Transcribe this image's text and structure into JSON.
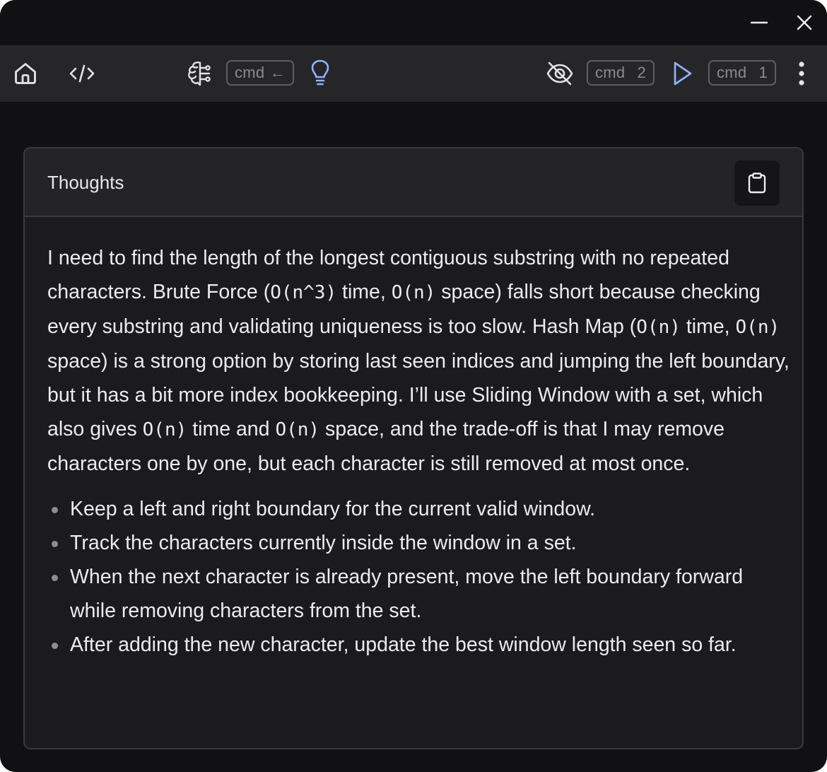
{
  "window_controls": {
    "minimize_icon": "minimize-icon",
    "close_icon": "close-icon"
  },
  "toolbar": {
    "left_icons": [
      "home-icon",
      "code-icon"
    ],
    "reasoning_icon": "brain-icon",
    "reasoning_shortcut": {
      "mod": "cmd",
      "key": "←"
    },
    "hint_icon": "lightbulb-icon",
    "hide_icon": "eye-off-icon",
    "hide_shortcut": {
      "mod": "cmd",
      "key": "2"
    },
    "run_icon": "play-icon",
    "run_shortcut": {
      "mod": "cmd",
      "key": "1"
    },
    "menu_icon": "more-vertical-icon"
  },
  "colors": {
    "accent": "#8fb4ff",
    "window_bg": "#111113",
    "toolbar_bg": "#262629",
    "card_bg": "#1b1b1e"
  },
  "thoughts": {
    "title": "Thoughts",
    "copy_icon": "clipboard-icon",
    "paragraph": {
      "t1": "I need to find the length of the longest contiguous substring with no repeated characters. Brute Force (",
      "c1": "O(n^3)",
      "t2": " time, ",
      "c2": "O(n)",
      "t3": " space) falls short because checking every substring and validating uniqueness is too slow. Hash Map (",
      "c3": "O(n)",
      "t4": " time, ",
      "c4": "O(n)",
      "t5": " space) is a strong option by storing last seen indices and jumping the left boundary, but it has a bit more index bookkeeping. I’ll use Sliding Window with a set, which also gives ",
      "c5": "O(n)",
      "t6": " time and ",
      "c6": "O(n)",
      "t7": " space, and the trade-off is that I may remove characters one by one, but each character is still removed at most once."
    },
    "bullets": [
      "Keep a left and right boundary for the current valid window.",
      "Track the characters currently inside the window in a set.",
      "When the next character is already present, move the left boundary forward while removing characters from the set.",
      "After adding the new character, update the best window length seen so far."
    ]
  }
}
